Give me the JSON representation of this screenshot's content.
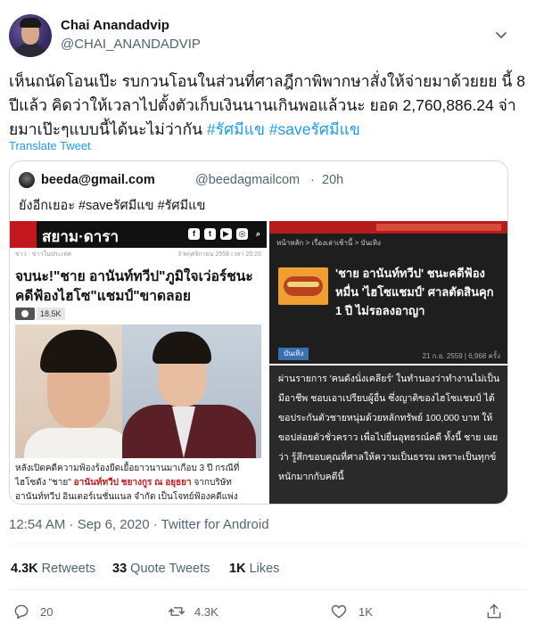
{
  "author": {
    "display_name": "Chai Anandadvip",
    "handle": "@CHAI_ANANDADVIP"
  },
  "tweet": {
    "text_main": "เห็นถนัดโอนเป๊ะ รบกวนโอนในส่วนที่ศาลฎีกาพิพากษาสั่งให้จ่ายมาด้วยยย นี้ 8 ปีแล้ว คิดว่าให้เวลาไปตั้งตัวเก็บเงินนานเกินพอแล้วนะ ยอด 2,760,886.24 จ่ายมาเป๊ะๆแบบนี้ได้นะไม่ว่ากัน",
    "hashtag_1": "#รัศมีแข",
    "hashtag_2": "#saveรัศมีแข",
    "translate_label": "Translate Tweet"
  },
  "quote": {
    "name": "beeda@gmail.com",
    "handle": "@beedagmailcom",
    "dot": "·",
    "time": "20h",
    "text": "ยังอีกเยอะ #saveรัศมีแข #รัศมีแข"
  },
  "collage": {
    "left": {
      "brand": "สยาม·ดารา",
      "meta_left": "ข่าว  ·  ข่าวในประเทศ",
      "meta_right": "3 พฤศจิกายน 2558 เวลา 20:20",
      "headline": "จบนะ!\"ชาย อานันท์ทวีป\"ภูมิใจเว่อร์ชนะคดีฟ้องไฮโซ\"แชมป์\"ขาดลอย",
      "views": "18.5K",
      "body_1": "หลังเปิดคดีความฟ้องร้องยืดเยื้อยาวนานมาเกือบ 3 ปี กรณีที่",
      "body_2": "ไฮโซดัง \"ชาย\" ",
      "body_2_red": "อานันท์ทวีป ชยางกูร ณ อยุธยา",
      "body_2_end": " จากบริษัท",
      "body_3": "อานันท์ทวีป อินเตอร์เนชั่นแนล จำกัด เป็นโจทย์ฟ้องคดีแพ่ง"
    },
    "right_top": {
      "crumbs": "หน้าหลัก  >  เรื่องเล่าเช้านี้  >  บันเทิง",
      "headline": "'ชาย อานันท์ทวีป' ชนะคดีฟ้องหมื่น 'ไฮโซแชมป์' ศาลตัดสินคุก 1 ปี ไม่รอลงอาญา",
      "tag": "บันเทิง",
      "date": "21 ก.ย. 2559 | 6,968 ครั้ง"
    },
    "right_bottom": {
      "text": "ผ่านรายการ 'คนดังนั่งเคลียร์' ในทำนองว่าทำงานไม่เป็นมีอาชีพ ชอบเอาเปรียบผู้อื่น ซึ่งญาติของไฮโซแชมป์ ได้ขอประกันตัวชายหนุ่มด้วยหลักทรัพย์ 100,000 บาท ให้ขอปล่อยตัวชั่วคราว เพื่อไปยื่นอุทธรณ์คดี ทั้งนี้ ชาย เผยว่า รู้สึกขอบคุณที่ศาลให้ความเป็นธรรม เพราะเป็นทุกข์หนักมากกับคดีนี้"
    }
  },
  "timestamp": "12:54 AM · Sep 6, 2020 · Twitter for Android",
  "stats": {
    "retweets_count": "4.3K",
    "retweets_label": "Retweets",
    "quotes_count": "33",
    "quotes_label": "Quote Tweets",
    "likes_count": "1K",
    "likes_label": "Likes"
  },
  "actions": {
    "reply_count": "20",
    "retweet_count": "4.3K",
    "like_count": "1K",
    "reply_icon": "reply-icon",
    "retweet_icon": "retweet-icon",
    "like_icon": "heart-icon",
    "share_icon": "share-icon"
  },
  "colors": {
    "link": "#1d9bf0",
    "secondary_text": "#536471",
    "news_red": "#c4161c"
  }
}
